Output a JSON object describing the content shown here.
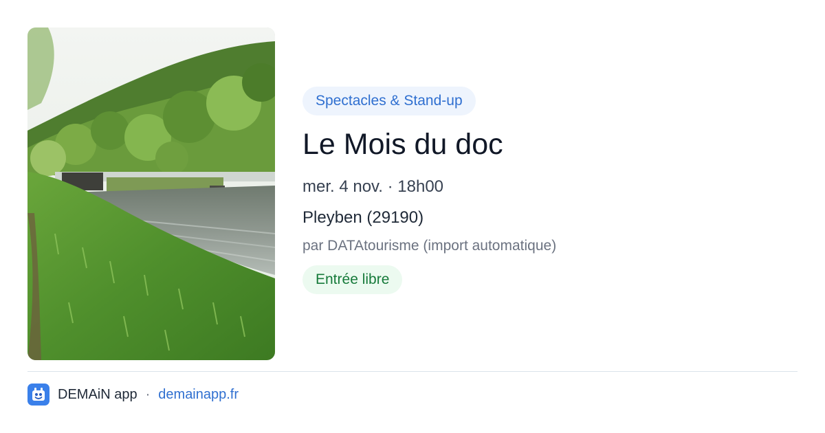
{
  "event": {
    "category": "Spectacles & Stand-up",
    "title": "Le Mois du doc",
    "datetime": "mer. 4 nov. · 18h00",
    "location": "Pleyben (29190)",
    "author": "par DATAtourisme (import automatique)",
    "price": "Entrée libre"
  },
  "footer": {
    "app_name": "DEMAiN app",
    "separator": "·",
    "link": "demainapp.fr"
  },
  "icons": {
    "app": "demain-app-icon"
  },
  "colors": {
    "category_chip_bg": "#eef4fd",
    "category_chip_text": "#2f6fd0",
    "price_chip_bg": "#ecfaf0",
    "price_chip_text": "#167a3a",
    "link": "#2f6fd0"
  }
}
